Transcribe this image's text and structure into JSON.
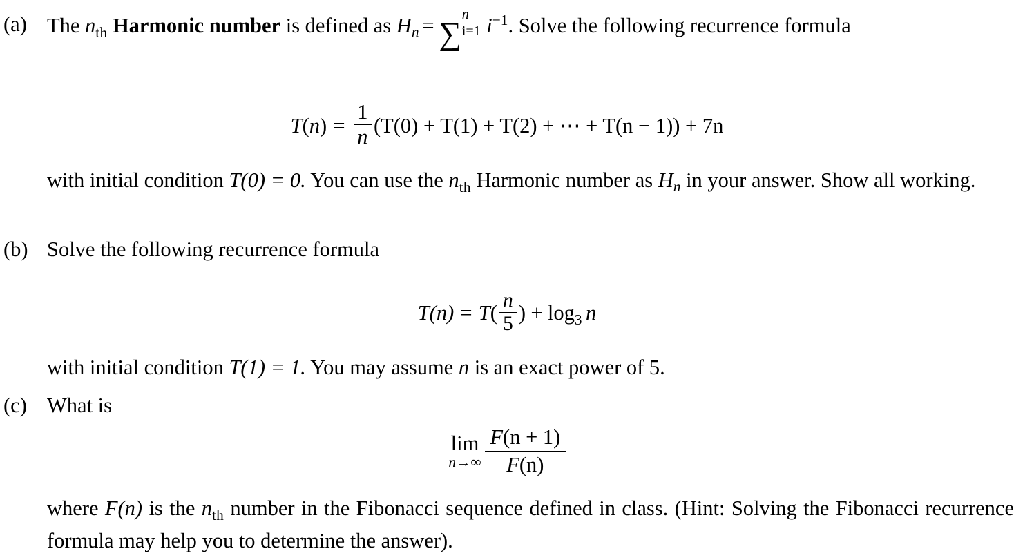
{
  "document": {
    "background": "#ffffff",
    "text_color": "#000000",
    "items": [
      {
        "label": "(a)",
        "lead_text_1": "The ",
        "bold_term": "Harmonic number",
        "lead_text_2": " is defined as ",
        "nth_n": "n",
        "nth_th": "th",
        "harmonic_def": {
          "H": "H",
          "H_sub": "n",
          "equals": "=",
          "sigma": "∑",
          "sum_upper": "n",
          "sum_lower": "i=1",
          "summand": "i",
          "summand_exp": "−1",
          "period": "."
        },
        "lead_text_3": " Solve the following recurrence formula",
        "equation": {
          "lhs_T": "T",
          "lhs_open": "(",
          "lhs_arg": "n",
          "lhs_close": ")",
          "equals": "=",
          "frac_num": "1",
          "frac_den": "n",
          "body": "(T(0) + T(1) + T(2) + ⋯ + T(n − 1)) + 7n",
          "terms": [
            "T(0)",
            "T(1)",
            "T(2)",
            "⋯",
            "T(n − 1)"
          ],
          "trailing": "+ 7n"
        },
        "after_text_1": "with initial condition ",
        "after_math_1": "T(0) = 0.",
        "after_text_2": " You can use the ",
        "after_text_3": " Harmonic number as ",
        "after_math_2": "H",
        "after_math_2_sub": "n",
        "after_text_4": " in your answer. Show all working."
      },
      {
        "label": "(b)",
        "lead_text_1": "Solve the following recurrence formula",
        "equation": {
          "lhs": "T(n)",
          "equals": "=",
          "rhs_T": "T",
          "open": "(",
          "frac_num": "n",
          "frac_den": "5",
          "close": ")",
          "plus": "+",
          "log": "log",
          "log_base": "3",
          "log_arg": "n"
        },
        "after_text_1": "with initial condition ",
        "after_math_1": "T(1) = 1.",
        "after_text_2": " You may assume ",
        "after_math_2": "n",
        "after_text_3": " is an exact power of 5."
      },
      {
        "label": "(c)",
        "lead_text_1": "What is",
        "equation": {
          "lim": "lim",
          "lim_var": "n",
          "lim_arrow": "→",
          "lim_target": "∞",
          "num_F": "F",
          "num_body": "(n + 1)",
          "den_F": "F",
          "den_body": "(n)"
        },
        "after_text_1": "where ",
        "after_math_1": "F(n)",
        "after_text_2": " is the ",
        "after_text_3": " number in the Fibonacci sequence defined in class. (Hint: Solving the Fibonacci recurrence formula may help you to determine the answer)."
      }
    ]
  }
}
